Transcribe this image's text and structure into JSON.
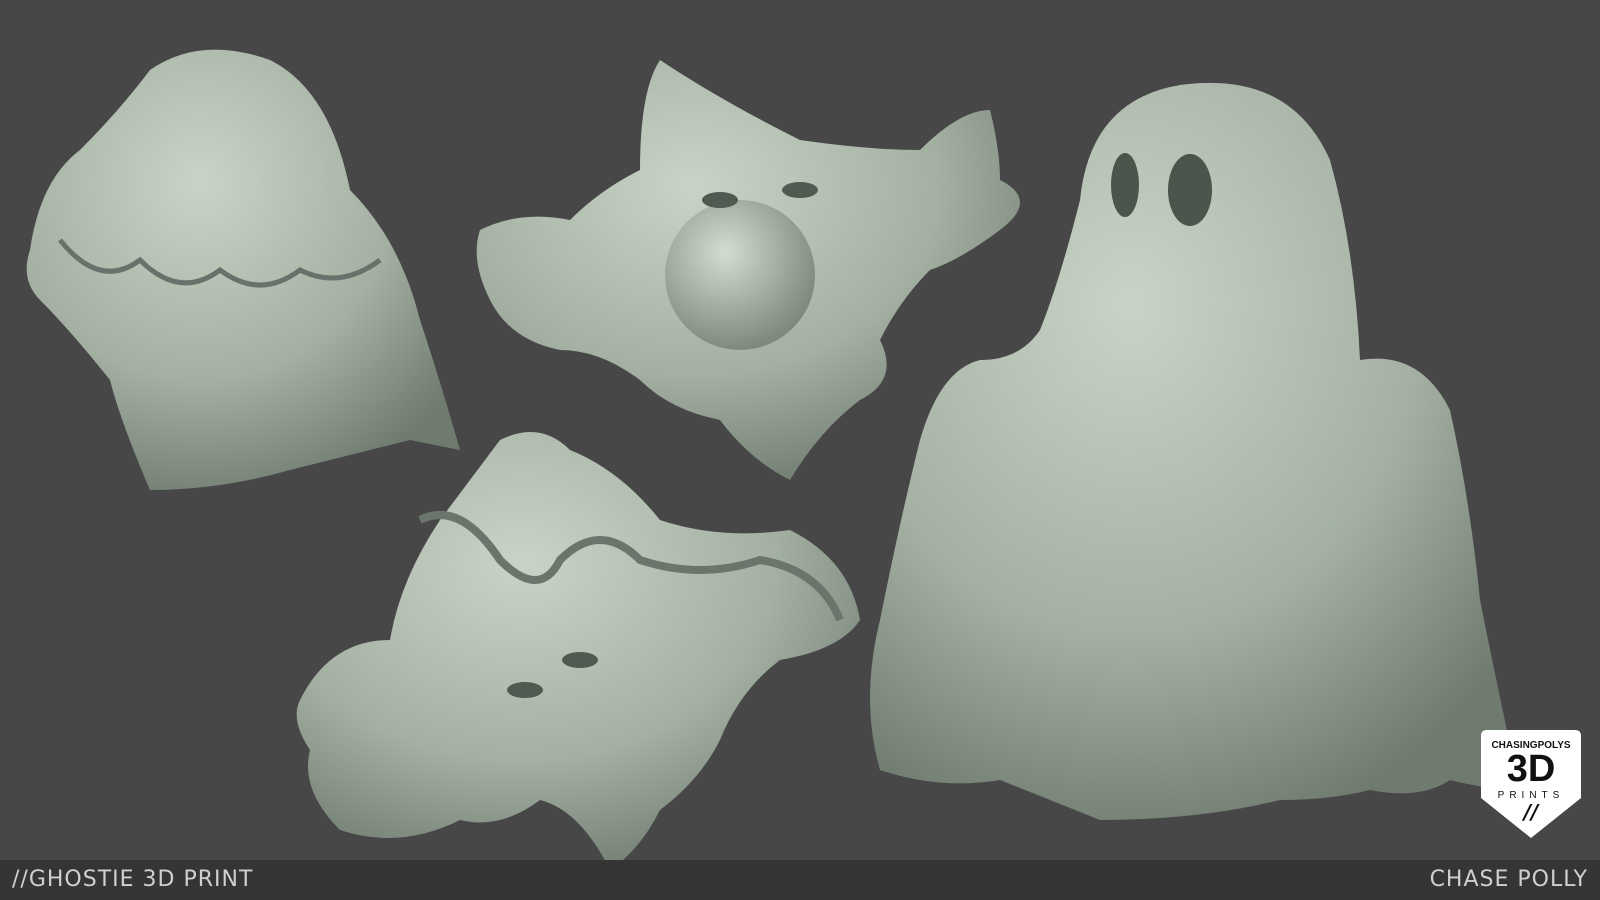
{
  "footer": {
    "title": "//GHOSTIE 3D PRINT",
    "author": "CHASE POLLY"
  },
  "logo": {
    "brand": "CHASINGPOLYS",
    "big": "3D",
    "sub": "PRINTS",
    "mark": "//"
  },
  "colors": {
    "background": "#474747",
    "footer": "#353535",
    "model": "#a9b5a8"
  }
}
